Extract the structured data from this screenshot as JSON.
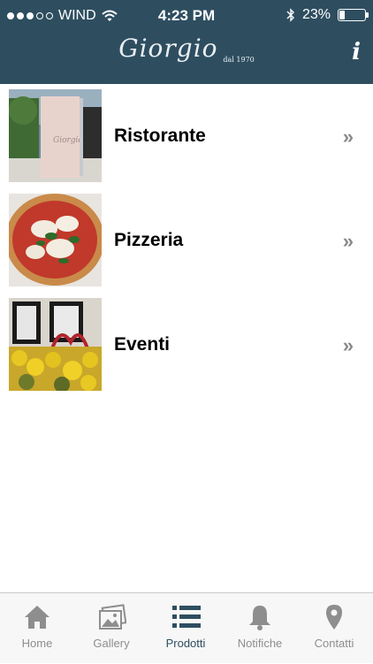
{
  "status_bar": {
    "carrier": "WIND",
    "time": "4:23 PM",
    "battery_text": "23%",
    "battery_level": 0.23
  },
  "header": {
    "brand": "Giorgio",
    "brand_sub": "dal 1970",
    "info_label": "i"
  },
  "list": [
    {
      "label": "Ristorante",
      "chevron": "»",
      "icon": "menu-card-photo"
    },
    {
      "label": "Pizzeria",
      "chevron": "»",
      "icon": "pizza-photo"
    },
    {
      "label": "Eventi",
      "chevron": "»",
      "icon": "flowers-photo"
    }
  ],
  "tabs": [
    {
      "label": "Home",
      "icon": "home-icon",
      "active": false
    },
    {
      "label": "Gallery",
      "icon": "gallery-icon",
      "active": false
    },
    {
      "label": "Prodotti",
      "icon": "list-icon",
      "active": true
    },
    {
      "label": "Notifiche",
      "icon": "bell-icon",
      "active": false
    },
    {
      "label": "Contatti",
      "icon": "location-pin-icon",
      "active": false
    }
  ],
  "colors": {
    "header_bg": "#2e4e60",
    "tab_active": "#2e4e60",
    "tab_inactive": "#8e8e8e"
  }
}
